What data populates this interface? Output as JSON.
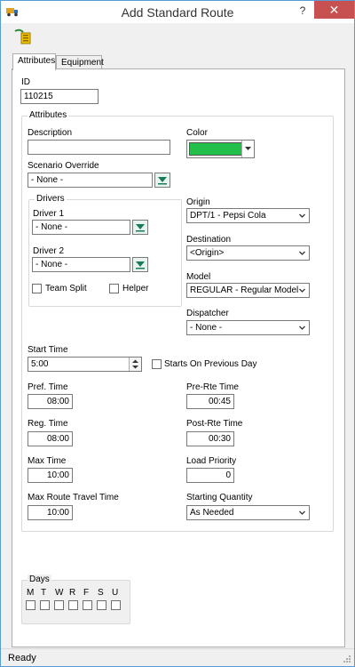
{
  "window": {
    "title": "Add Standard Route",
    "help": "?",
    "close": "✕"
  },
  "tabs": [
    {
      "label": "Attributes"
    },
    {
      "label": "Equipment"
    }
  ],
  "id_field": {
    "label": "ID",
    "value": "110215"
  },
  "attributes_group": {
    "caption": "Attributes"
  },
  "description": {
    "label": "Description",
    "value": ""
  },
  "color": {
    "label": "Color",
    "value": "#22c04a"
  },
  "scenario_override": {
    "label": "Scenario Override",
    "value": "- None -"
  },
  "drivers": {
    "caption": "Drivers",
    "driver1": {
      "label": "Driver 1",
      "value": "- None -"
    },
    "driver2": {
      "label": "Driver 2",
      "value": "- None -"
    },
    "team_split": "Team Split",
    "helper": "Helper"
  },
  "origin": {
    "label": "Origin",
    "value": "DPT/1 - Pepsi Cola"
  },
  "destination": {
    "label": "Destination",
    "value": "<Origin>"
  },
  "model": {
    "label": "Model",
    "value": "REGULAR - Regular Model"
  },
  "dispatcher": {
    "label": "Dispatcher",
    "value": "- None -"
  },
  "start_time": {
    "label": "Start Time",
    "value": "5:00",
    "starts_previous_day": "Starts On Previous Day"
  },
  "pref_time": {
    "label": "Pref. Time",
    "value": "08:00"
  },
  "pre_rte_time": {
    "label": "Pre-Rte Time",
    "value": "00:45"
  },
  "reg_time": {
    "label": "Reg. Time",
    "value": "08:00"
  },
  "post_rte_time": {
    "label": "Post-Rte Time",
    "value": "00:30"
  },
  "max_time": {
    "label": "Max Time",
    "value": "10:00"
  },
  "load_priority": {
    "label": "Load Priority",
    "value": "0"
  },
  "max_route_travel_time": {
    "label": "Max Route Travel Time",
    "value": "10:00"
  },
  "starting_quantity": {
    "label": "Starting Quantity",
    "value": "As Needed"
  },
  "days": {
    "caption": "Days",
    "letters": [
      "M",
      "T",
      "W",
      "R",
      "F",
      "S",
      "U"
    ]
  },
  "status": {
    "text": "Ready"
  }
}
